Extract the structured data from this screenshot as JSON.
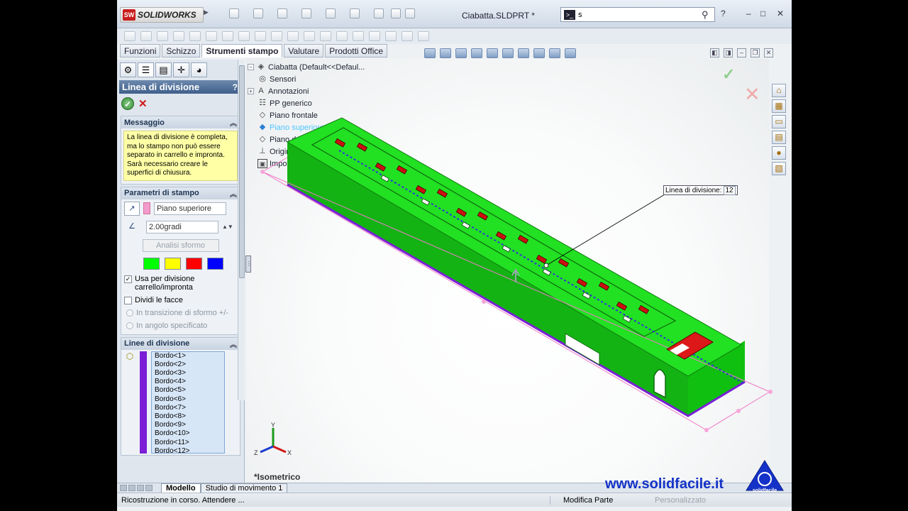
{
  "app": {
    "brand": "SOLIDWORKS",
    "brand_badge": "SW",
    "document_title": "Ciabatta.SLDPRT *",
    "search_value": "s",
    "help": "?"
  },
  "command_tabs": [
    "Funzioni",
    "Schizzo",
    "Strumenti stampo",
    "Valutare",
    "Prodotti Office"
  ],
  "property_manager": {
    "title": "Linea di divisione",
    "help": "?",
    "message_group": {
      "title": "Messaggio",
      "text": "La linea di divisione è completa, ma lo stampo non può essere separato in carrello e impronta. Sarà necessario creare le superfici di chiusura."
    },
    "params_group": {
      "title": "Parametri di stampo",
      "direction_value": "Piano superiore",
      "angle_value": "2.00gradi",
      "analysis_button": "Analisi sformo",
      "swatch_colors": [
        "#00ff00",
        "#ffff00",
        "#ff0000",
        "#0000ff"
      ],
      "use_for_split_label": "Usa per divisione carrello/impronta",
      "split_faces_label": "Dividi le facce",
      "radio_transition": "In transizione di sformo +/-",
      "radio_angle": "In angolo specificato"
    },
    "lines_group": {
      "title": "Linee di divisione",
      "edges": [
        "Bordo<1>",
        "Bordo<2>",
        "Bordo<3>",
        "Bordo<4>",
        "Bordo<5>",
        "Bordo<6>",
        "Bordo<7>",
        "Bordo<8>",
        "Bordo<9>",
        "Bordo<10>",
        "Bordo<11>",
        "Bordo<12>"
      ]
    }
  },
  "tree": {
    "root": "Ciabatta  (Default<<Defaul...",
    "items": [
      "Sensori",
      "Annotazioni",
      "PP generico",
      "Piano frontale",
      "Piano superiore",
      "Piano destro",
      "Origine",
      "Importato3"
    ]
  },
  "viewport": {
    "view_name": "*Isometrico",
    "callout_label": "Linea di divisione:",
    "callout_value": "12",
    "triad_x": "X",
    "triad_y": "Y",
    "triad_z": "Z"
  },
  "bottom_tabs": [
    "Modello",
    "Studio di movimento 1"
  ],
  "status": {
    "left": "Ricostruzione in corso. Attendere ...",
    "mode": "Modifica Parte",
    "custom": "Personalizzato"
  },
  "watermark": {
    "url": "www.solidfacile.it",
    "logo_text": "solidfacile"
  },
  "colors": {
    "part_green": "#22e022",
    "parting_line": "#7a1fd6",
    "title_accent": "#3f5f8b"
  }
}
